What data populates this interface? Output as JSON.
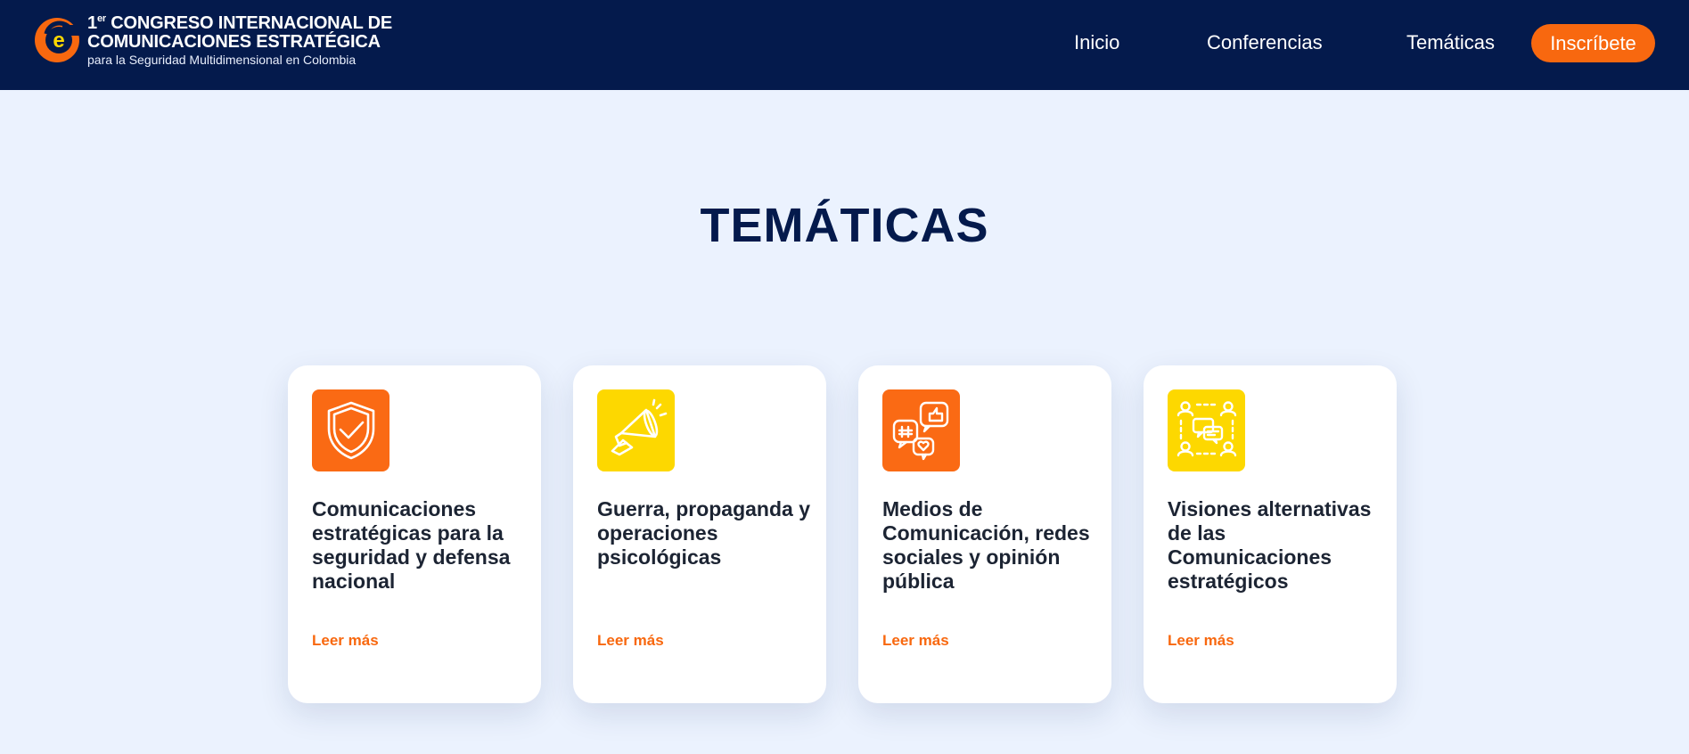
{
  "header": {
    "logo": {
      "mark_letter": "e",
      "line1_prefix": "1",
      "line1_sup": "er",
      "line1_rest": " CONGRESO INTERNACIONAL DE",
      "line2": "COMUNICACIONES ESTRATÉGICA",
      "line3": "para la Seguridad Multidimensional en Colombia"
    },
    "nav": {
      "inicio": "Inicio",
      "conferencias": "Conferencias",
      "tematicas": "Temáticas",
      "cta": "Inscríbete"
    }
  },
  "main": {
    "title": "TEMÁTICAS",
    "cards": [
      {
        "icon": "shield-check-icon",
        "title": "Comunicaciones estratégicas para la seguridad y defensa nacional",
        "link": "Leer más"
      },
      {
        "icon": "megaphone-icon",
        "title": "Guerra, propaganda y operaciones psicológicas",
        "link": "Leer más"
      },
      {
        "icon": "social-media-icon",
        "title": "Medios de Comunicación, redes sociales y opinión pública",
        "link": "Leer más"
      },
      {
        "icon": "network-people-icon",
        "title": "Visiones alternativas de las Comunicaciones estratégicos",
        "link": "Leer más"
      }
    ]
  },
  "colors": {
    "navy": "#041a4c",
    "orange": "#f8680f",
    "yellow": "#fdd800",
    "background": "#ebf2fe"
  }
}
